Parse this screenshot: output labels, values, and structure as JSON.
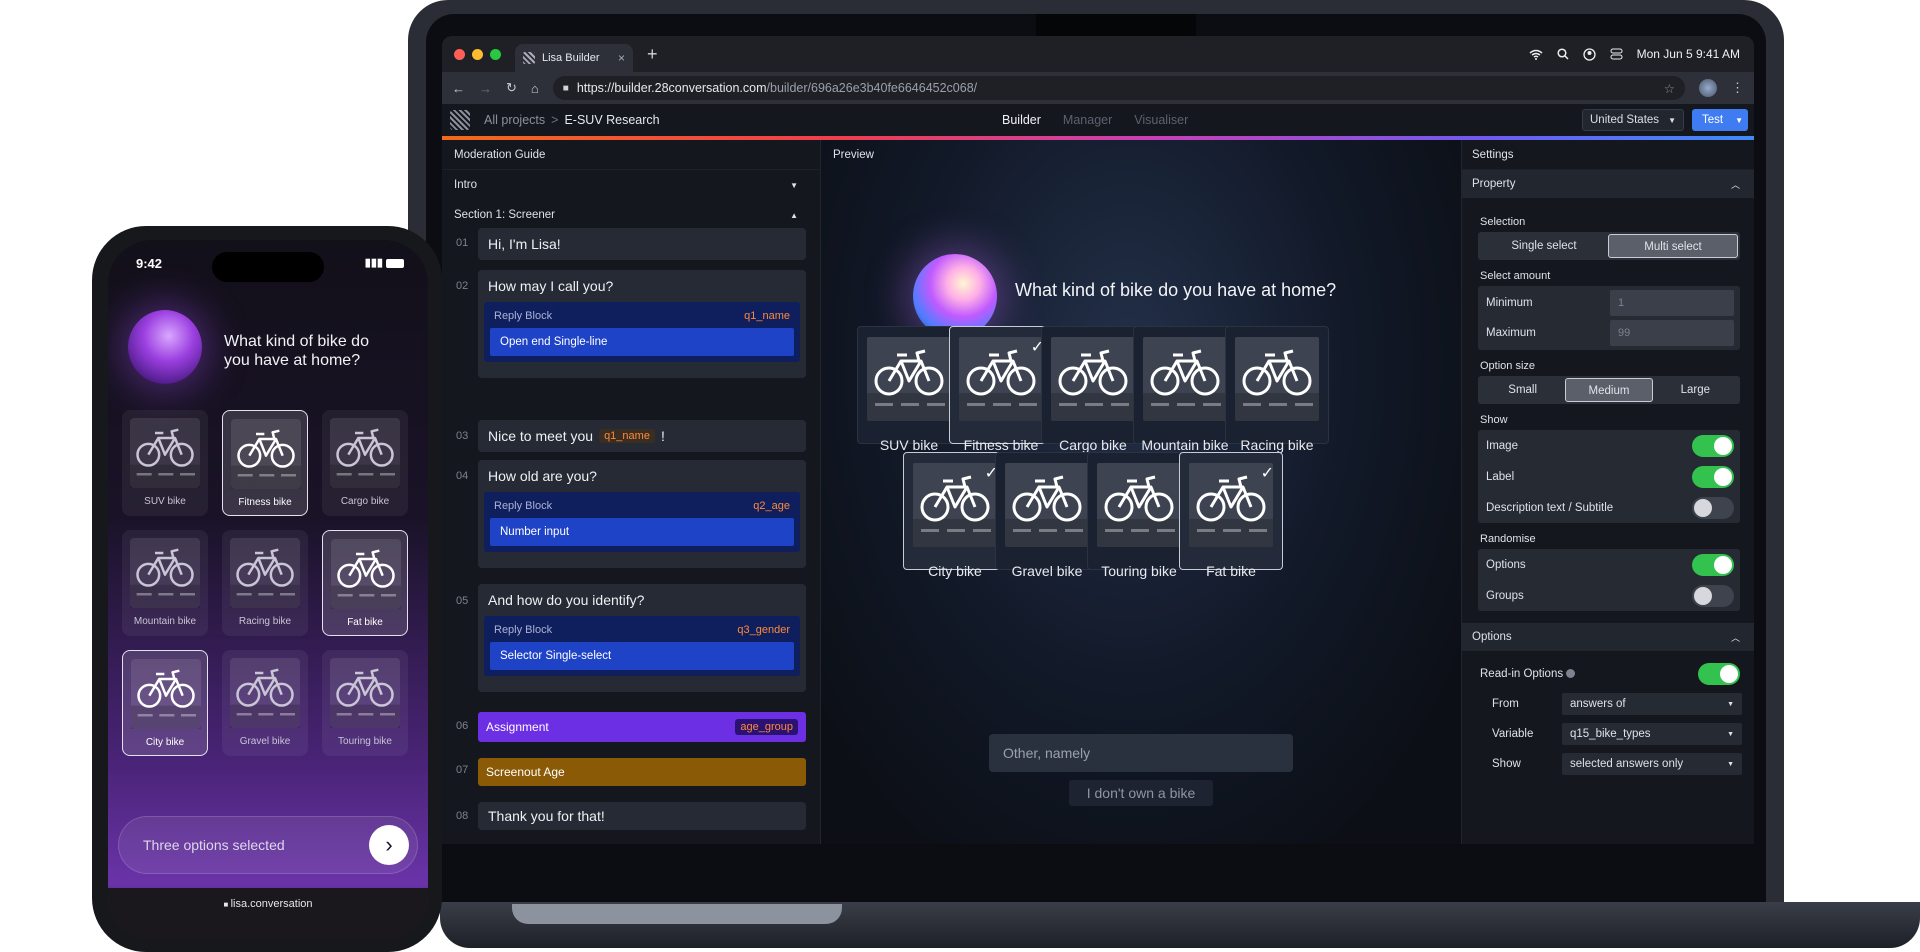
{
  "browser": {
    "tab_title": "Lisa Builder",
    "tab_close": "×",
    "new_tab": "+",
    "clock": "Mon Jun 5  9:41 AM",
    "url_host": "https://builder.28conversation.com",
    "url_path": "/builder/696a26e3b40fe6646452c068/"
  },
  "app": {
    "breadcrumb_root": "All projects",
    "breadcrumb_sep": ">",
    "breadcrumb_current": "E-SUV Research",
    "nav": [
      "Builder",
      "Manager",
      "Visualiser"
    ],
    "country": "United States",
    "test_button": "Test"
  },
  "moderation": {
    "title": "Moderation Guide",
    "intro": "Intro",
    "section": "Section 1: Screener",
    "items": [
      {
        "num": "01",
        "text": "Hi, I'm Lisa!"
      },
      {
        "num": "02",
        "text": "How may I call you?",
        "reply_label": "Reply Block",
        "var": "q1_name",
        "type": "Open end Single-line"
      },
      {
        "num": "03",
        "text_before": "Nice to meet you",
        "chip": "q1_name",
        "text_after": "!"
      },
      {
        "num": "04",
        "text": "How old are you?",
        "reply_label": "Reply Block",
        "var": "q2_age",
        "type": "Number input"
      },
      {
        "num": "05",
        "text": "And how do you identify?",
        "reply_label": "Reply Block",
        "var": "q3_gender",
        "type": "Selector Single-select"
      },
      {
        "num": "06",
        "text": "Assignment",
        "tag": "age_group"
      },
      {
        "num": "07",
        "text": "Screenout Age"
      },
      {
        "num": "08",
        "text": "Thank you for that!"
      }
    ]
  },
  "preview": {
    "title": "Preview",
    "question": "What kind of bike do you have at home?",
    "options": [
      {
        "label": "SUV bike",
        "selected": false
      },
      {
        "label": "Fitness bike",
        "selected": true
      },
      {
        "label": "Cargo bike",
        "selected": false
      },
      {
        "label": "Mountain bike",
        "selected": false
      },
      {
        "label": "Racing bike",
        "selected": false
      },
      {
        "label": "City bike",
        "selected": true
      },
      {
        "label": "Gravel bike",
        "selected": false
      },
      {
        "label": "Touring bike",
        "selected": false
      },
      {
        "label": "Fat bike",
        "selected": true
      }
    ],
    "check": "✓",
    "other_placeholder": "Other, namely",
    "no_bike": "I don't own a bike"
  },
  "settings": {
    "title": "Settings",
    "property": "Property",
    "selection_label": "Selection",
    "selection_options": [
      "Single select",
      "Multi select"
    ],
    "amount_label": "Select amount",
    "minimum_label": "Minimum",
    "minimum_value": "1",
    "maximum_label": "Maximum",
    "maximum_value": "99",
    "size_label": "Option size",
    "size_options": [
      "Small",
      "Medium",
      "Large"
    ],
    "show_label": "Show",
    "show_image": "Image",
    "show_label_item": "Label",
    "show_desc": "Description text / Subtitle",
    "randomise_label": "Randomise",
    "rand_options": "Options",
    "rand_groups": "Groups",
    "options_section": "Options",
    "readin": "Read-in Options",
    "from_label": "From",
    "from_value": "answers of",
    "variable_label": "Variable",
    "variable_value": "q15_bike_types",
    "show_sel_label": "Show",
    "show_sel_value": "selected answers only"
  },
  "phone": {
    "time": "9:42",
    "question": "What kind of bike do you have at home?",
    "options": [
      {
        "label": "SUV bike",
        "selected": false
      },
      {
        "label": "Fitness bike",
        "selected": true
      },
      {
        "label": "Cargo bike",
        "selected": false
      },
      {
        "label": "Mountain bike",
        "selected": false
      },
      {
        "label": "Racing bike",
        "selected": false
      },
      {
        "label": "Fat bike",
        "selected": true
      },
      {
        "label": "City bike",
        "selected": true
      },
      {
        "label": "Gravel bike",
        "selected": false
      },
      {
        "label": "Touring bike",
        "selected": false
      }
    ],
    "status_text": "Three options selected",
    "go_icon": "›",
    "url": "lisa.conversation"
  },
  "colors": {
    "accent_blue": "#3f7cf1",
    "toggle_on": "#33c24d",
    "variable_orange": "#ff8a3c",
    "assignment_purple": "#6d2fe3",
    "screenout_amber": "#8a5a06"
  }
}
